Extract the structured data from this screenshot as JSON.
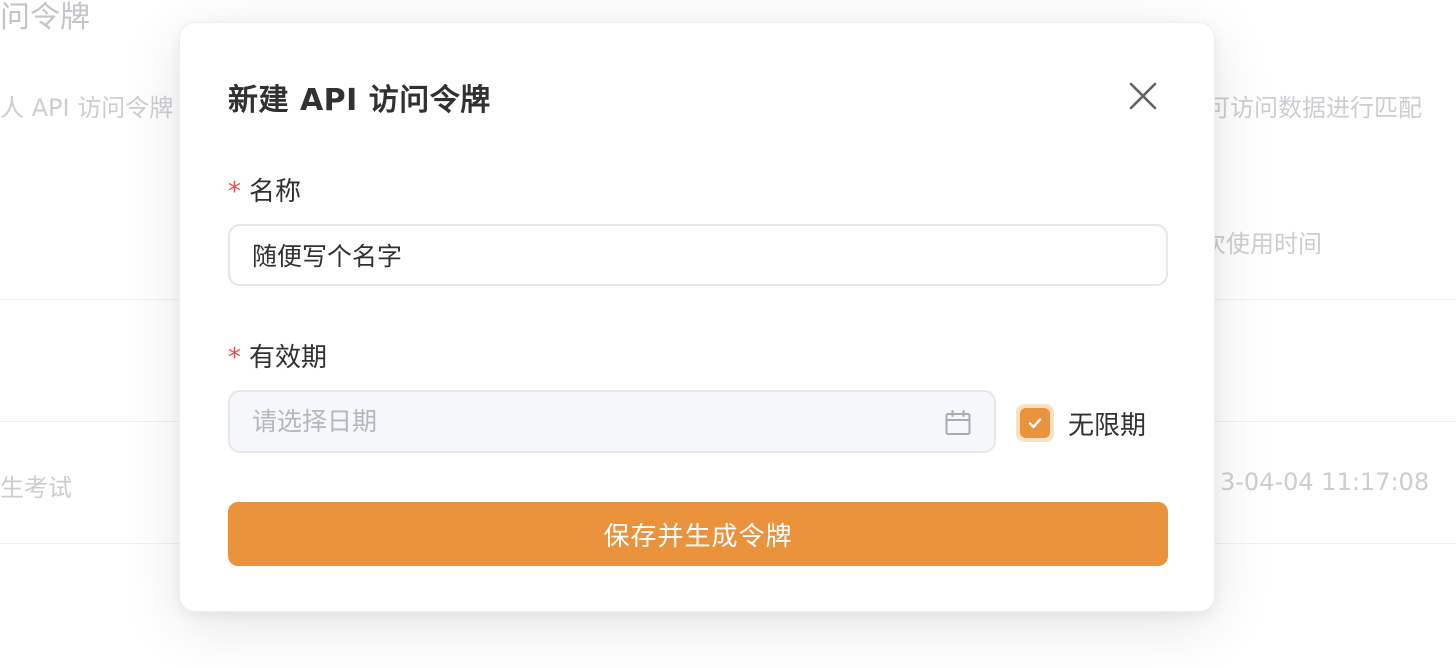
{
  "background": {
    "title": "问令牌",
    "desc_left": "人 API 访问令牌",
    "desc_right": "可访问数据进行匹配",
    "col_header": "次使用时间",
    "row_left": "生考试",
    "row_right": "3-04-04 11:17:08"
  },
  "modal": {
    "title": "新建 API 访问令牌",
    "close_icon": "close-icon",
    "name_field": {
      "required_mark": "*",
      "label": "名称",
      "value": "随便写个名字"
    },
    "expiry_field": {
      "required_mark": "*",
      "label": "有效期",
      "placeholder": "请选择日期",
      "icon": "calendar-icon",
      "unlimited_label": "无限期",
      "unlimited_checked": true
    },
    "submit_label": "保存并生成令牌"
  },
  "colors": {
    "accent": "#ea923c",
    "required": "#e05252",
    "text": "#303133",
    "placeholder": "#b4b7bd"
  }
}
